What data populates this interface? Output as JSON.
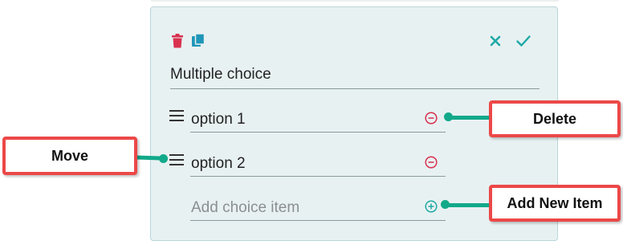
{
  "card": {
    "title_value": "Multiple choice",
    "options": [
      {
        "label": "option 1"
      },
      {
        "label": "option 2"
      }
    ],
    "add_placeholder": "Add choice item"
  },
  "annotations": {
    "delete": "Delete",
    "move": "Move",
    "add_new_item": "Add New Item"
  },
  "icons": {
    "delete_question": "trash-icon",
    "duplicate": "copy-icon",
    "cancel": "close-icon",
    "confirm": "check-icon",
    "drag": "drag-handle-icon",
    "remove_option": "minus-circle-icon",
    "add_option": "plus-circle-icon"
  },
  "colors": {
    "danger": "#d9304e",
    "accent": "#1ea9a6",
    "card_bg": "#e8f1f2",
    "callout_border": "#ec4848",
    "connector": "#12a98a"
  }
}
